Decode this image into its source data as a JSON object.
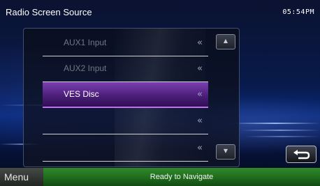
{
  "header": {
    "title": "Radio Screen Source",
    "clock": "05:54PM"
  },
  "sources": [
    {
      "label": "AUX1 Input",
      "chevron": "«",
      "state": "disabled"
    },
    {
      "label": "AUX2 Input",
      "chevron": "«",
      "state": "disabled"
    },
    {
      "label": "VES Disc",
      "chevron": "«",
      "state": "selected"
    },
    {
      "label": "",
      "chevron": "«",
      "state": "empty"
    },
    {
      "label": "",
      "chevron": "«",
      "state": "empty"
    }
  ],
  "scroll": {
    "up_icon": "▲",
    "down_icon": "▼"
  },
  "back": {
    "icon": "return-arrow-icon"
  },
  "bottom_bar": {
    "menu_label": "Menu",
    "status": "Ready to Navigate"
  },
  "colors": {
    "selected_accent": "#c76cf5",
    "selected_fill": "#5a2a8c",
    "status_bar": "#1f6a1c",
    "background": "#0a2a7a"
  }
}
